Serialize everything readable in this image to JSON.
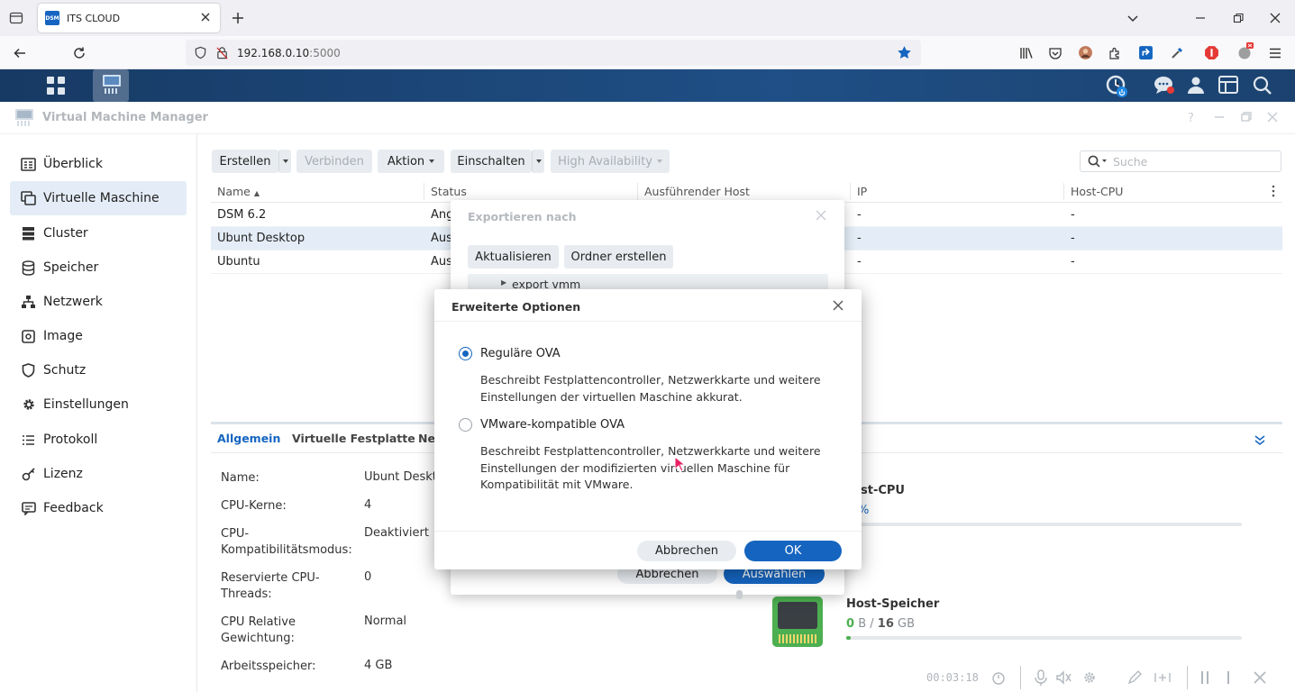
{
  "browser": {
    "tab_title": "ITS CLOUD",
    "favicon_text": "DSM",
    "url_host": "192.168.0.10",
    "url_port": ":5000"
  },
  "window": {
    "title": "Virtual Machine Manager"
  },
  "sidebar": {
    "items": [
      {
        "label": "Überblick",
        "icon": "overview-icon"
      },
      {
        "label": "Virtuelle Maschine",
        "icon": "virtual-machine-icon",
        "active": true
      },
      {
        "label": "Cluster",
        "icon": "cluster-icon"
      },
      {
        "label": "Speicher",
        "icon": "storage-icon"
      },
      {
        "label": "Netzwerk",
        "icon": "network-icon"
      },
      {
        "label": "Image",
        "icon": "image-icon"
      },
      {
        "label": "Schutz",
        "icon": "shield-icon"
      },
      {
        "label": "Einstellungen",
        "icon": "gear-icon"
      },
      {
        "label": "Protokoll",
        "icon": "log-icon"
      },
      {
        "label": "Lizenz",
        "icon": "key-icon"
      },
      {
        "label": "Feedback",
        "icon": "feedback-icon"
      }
    ]
  },
  "toolbar": {
    "create": "Erstellen",
    "connect": "Verbinden",
    "action": "Aktion",
    "power_on": "Einschalten",
    "high_availability": "High Availability",
    "search_placeholder": "Suche"
  },
  "table": {
    "columns": [
      "Name",
      "Status",
      "Ausführender Host",
      "IP",
      "Host-CPU"
    ],
    "rows": [
      {
        "name": "DSM 6.2",
        "status": "Ang",
        "ip": "-",
        "cpu": "-"
      },
      {
        "name": "Ubunt Desktop",
        "status": "Aus",
        "ip": "-",
        "cpu": "-",
        "selected": true
      },
      {
        "name": "Ubuntu",
        "status": "Aus",
        "ip": "-",
        "cpu": "-"
      }
    ]
  },
  "detail": {
    "tabs": [
      "Allgemein",
      "Virtuelle Festplatte",
      "Net"
    ],
    "fields": [
      {
        "label": "Name:",
        "value": "Ubunt Deskto"
      },
      {
        "label": "CPU-Kerne:",
        "value": "4"
      },
      {
        "label": "CPU-\nKompatibilitätsmodus:",
        "value": "Deaktiviert"
      },
      {
        "label": "Reservierte CPU-\nThreads:",
        "value": "0"
      },
      {
        "label": "CPU Relative\nGewichtung:",
        "value": "Normal"
      },
      {
        "label": "Arbeitsspeicher:",
        "value": "4 GB"
      }
    ]
  },
  "resources": {
    "cpu_title": "st-CPU",
    "cpu_value": "%",
    "mem_title": "Host-Speicher",
    "mem_used": "0",
    "mem_used_unit": "B",
    "mem_sep": "/",
    "mem_total": "16",
    "mem_total_unit": "GB",
    "mem_fraction": 0.004
  },
  "export_dialog": {
    "title": "Exportieren nach",
    "refresh": "Aktualisieren",
    "create_folder": "Ordner erstellen",
    "folder": "export vmm",
    "cancel": "Abbrechen",
    "select": "Auswählen"
  },
  "advanced_dialog": {
    "title": "Erweiterte Optionen",
    "options": [
      {
        "label": "Reguläre OVA",
        "desc": "Beschreibt Festplattencontroller, Netzwerkkarte und weitere Einstellungen der virtuellen Maschine akkurat.",
        "checked": true
      },
      {
        "label": "VMware-kompatible OVA",
        "desc": "Beschreibt Festplattencontroller, Netzwerkkarte und weitere Einstellungen der modifizierten virtuellen Maschine für Kompatibilität mit VMware.",
        "checked": false
      }
    ],
    "cancel": "Abbrechen",
    "ok": "OK"
  },
  "recorder": {
    "time": "00:03:18"
  },
  "colors": {
    "accent": "#1565c0",
    "dsm_bar": "#1f4f86",
    "selected_row": "#e4edf7"
  }
}
